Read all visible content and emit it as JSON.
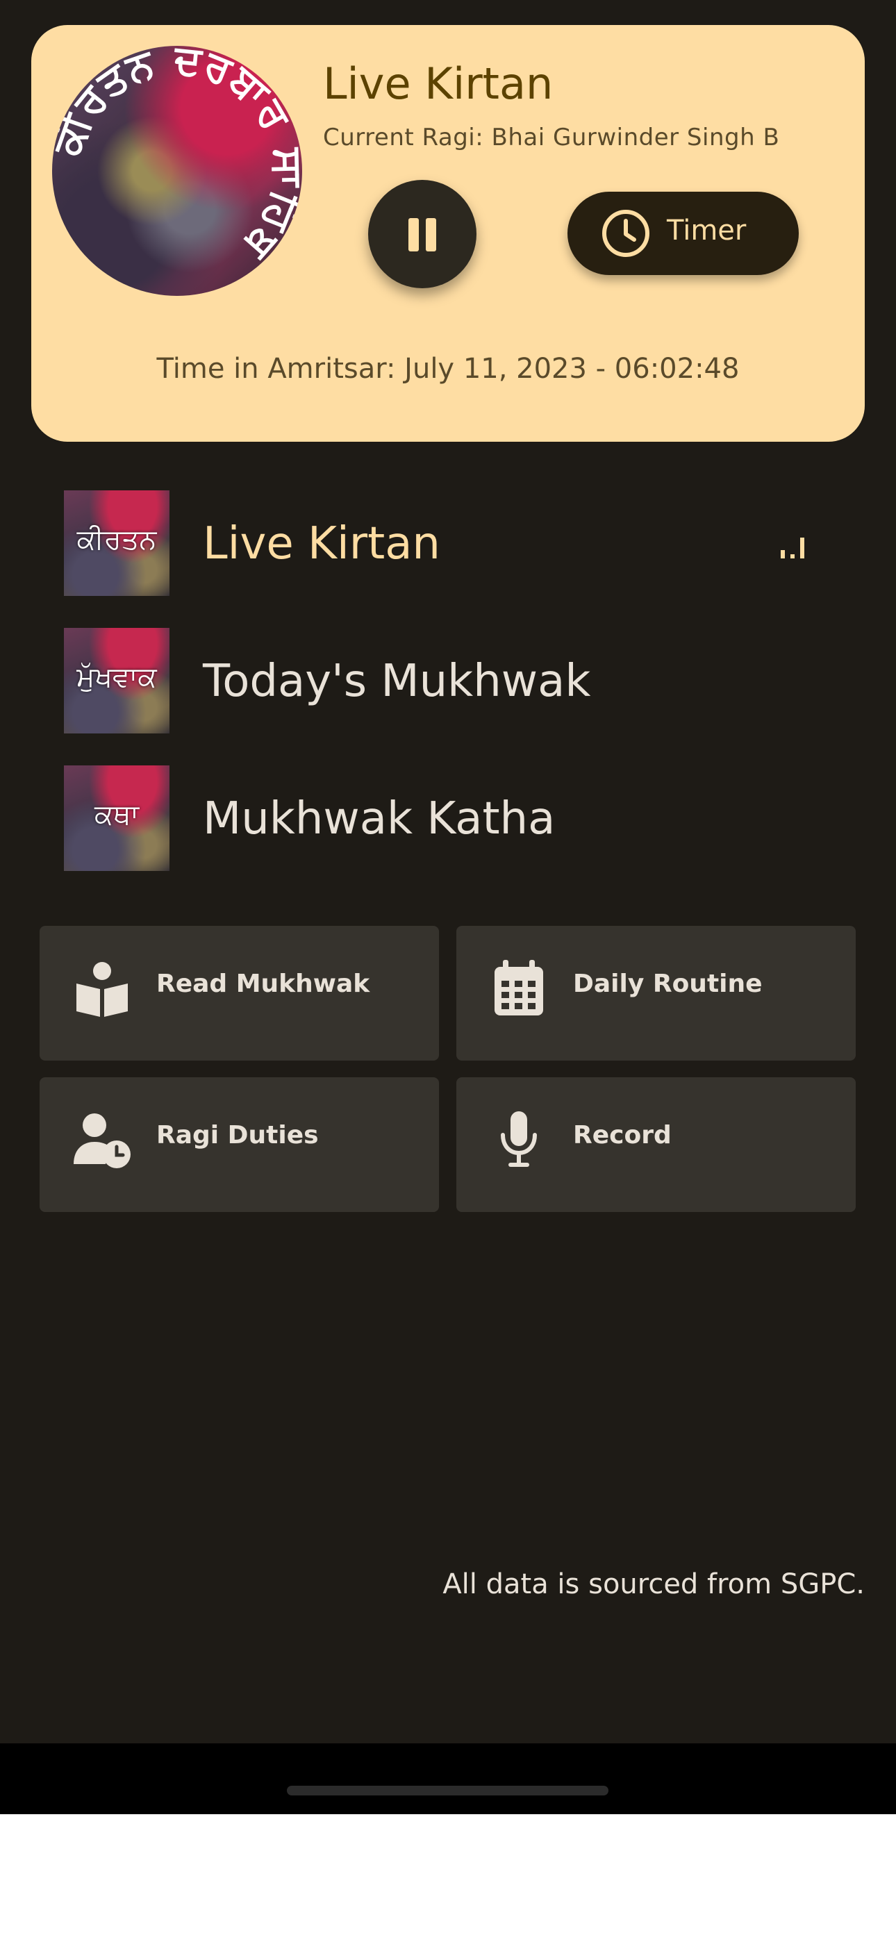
{
  "player": {
    "title": "Live Kirtan",
    "current_ragi": "Current Ragi: Bhai Gurwinder Singh B",
    "artwork_text": "ਕੀਰਤਨ ਦਰਬਾਰ ਸਾਹਿਬ",
    "state": "playing",
    "pause_icon": "pause-icon",
    "timer_label": "Timer",
    "timer_icon": "clock-icon",
    "amritsar_time": "Time in Amritsar: July 11, 2023 - 06:02:48"
  },
  "streams": [
    {
      "title": "Live Kirtan",
      "thumb_text": "ਕੀਰਤਨ",
      "active": true
    },
    {
      "title": "Today's Mukhwak",
      "thumb_text": "ਮੁੱਖਵਾਕ",
      "active": false
    },
    {
      "title": "Mukhwak Katha",
      "thumb_text": "ਕਥਾ",
      "active": false
    }
  ],
  "tiles": [
    {
      "label": "Read Mukhwak",
      "icon": "book-reader-icon"
    },
    {
      "label": "Daily Routine",
      "icon": "calendar-icon"
    },
    {
      "label": "Ragi Duties",
      "icon": "user-clock-icon"
    },
    {
      "label": "Record",
      "icon": "microphone-icon"
    }
  ],
  "footer": {
    "source_note": "All data is sourced from SGPC."
  },
  "colors": {
    "background": "#1e1b16",
    "card": "#fedda3",
    "accent": "#fedda3",
    "tile": "#36332d",
    "text": "#e9e2d8"
  }
}
